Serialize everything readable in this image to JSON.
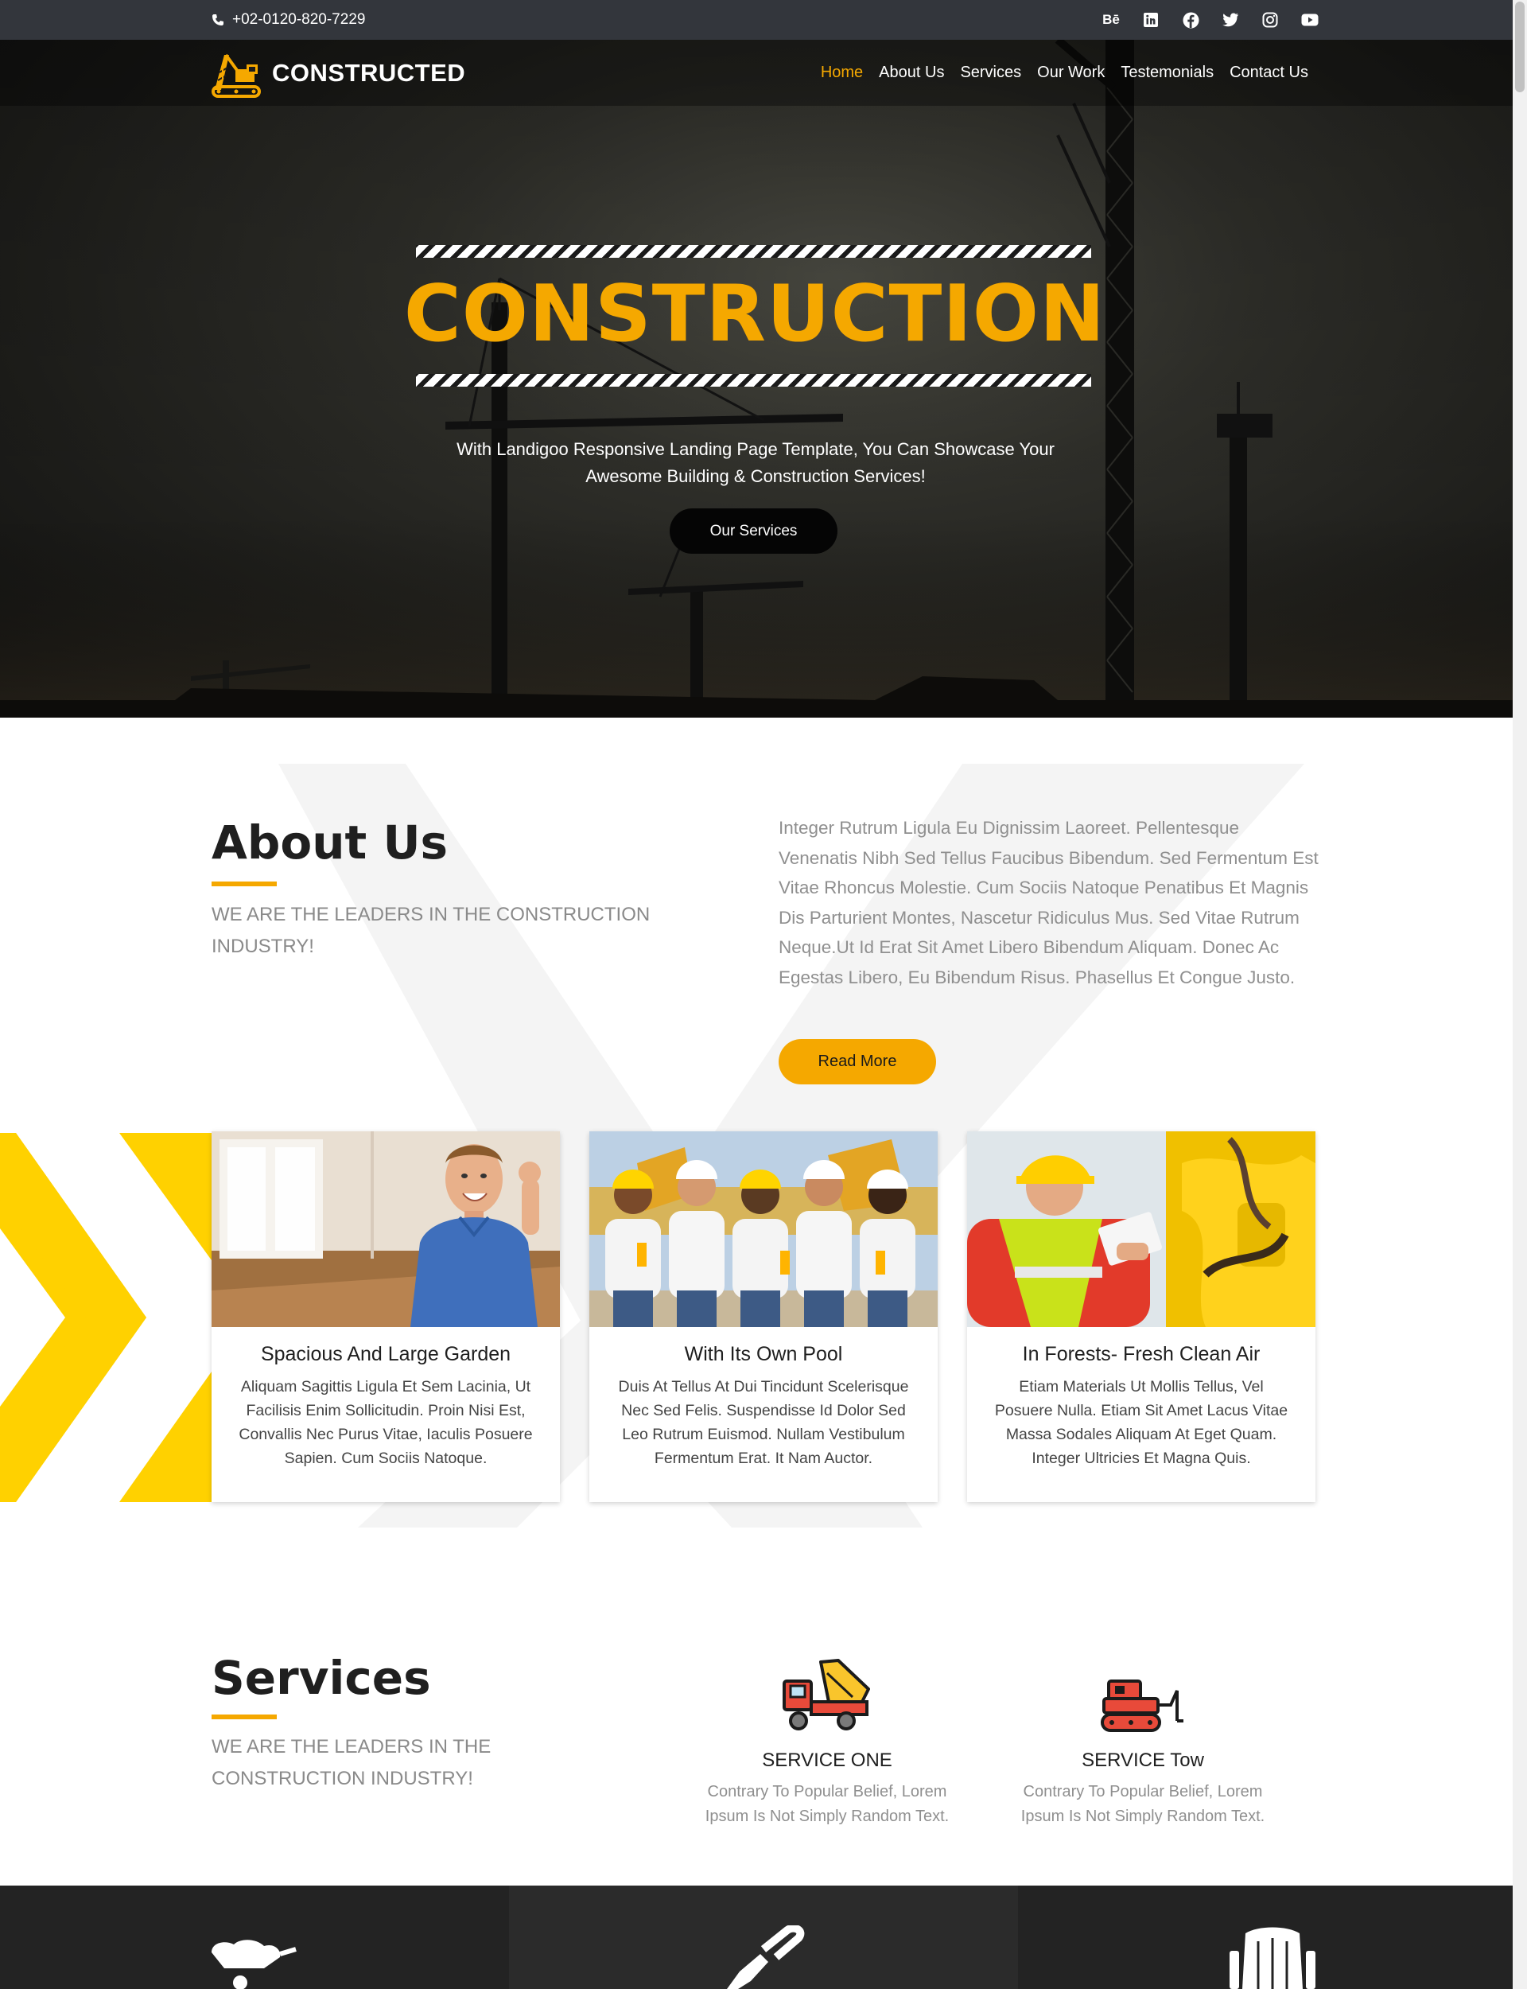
{
  "topbar": {
    "phone": "+02-0120-820-7229",
    "social": [
      {
        "icon": "behance-icon",
        "glyph": "Bē"
      },
      {
        "icon": "linkedin-icon",
        "glyph": "in"
      },
      {
        "icon": "facebook-icon",
        "glyph": "f"
      },
      {
        "icon": "twitter-icon",
        "glyph": "t"
      },
      {
        "icon": "instagram-icon",
        "glyph": "◎"
      },
      {
        "icon": "youtube-icon",
        "glyph": "▶"
      }
    ]
  },
  "brand": {
    "name": "CONSTRUCTED",
    "accent_color": "#f5a800"
  },
  "nav": {
    "items": [
      {
        "label": "Home",
        "active": true
      },
      {
        "label": "About Us",
        "active": false
      },
      {
        "label": "Services",
        "active": false
      },
      {
        "label": "Our Work",
        "active": false
      },
      {
        "label": "Testemonials",
        "active": false
      },
      {
        "label": "Contact Us",
        "active": false
      }
    ]
  },
  "hero": {
    "title": "CONSTRUCTION",
    "subtitle": "With Landigoo Responsive Landing Page Template, You Can Showcase Your Awesome Building & Construction Services!",
    "button": "Our Services"
  },
  "about": {
    "title": "About Us",
    "tagline": "WE ARE THE LEADERS IN THE CONSTRUCTION INDUSTRY!",
    "text": "Integer Rutrum Ligula Eu Dignissim Laoreet. Pellentesque Venenatis Nibh Sed Tellus Faucibus Bibendum. Sed Fermentum Est Vitae Rhoncus Molestie. Cum Sociis Natoque Penatibus Et Magnis Dis Parturient Montes, Nascetur Ridiculus Mus. Sed Vitae Rutrum Neque.Ut Id Erat Sit Amet Libero Bibendum Aliquam. Donec Ac Egestas Libero, Eu Bibendum Risus. Phasellus Et Congue Justo.",
    "button": "Read More"
  },
  "cards": [
    {
      "title": "Spacious And Large Garden",
      "text": "Aliquam Sagittis Ligula Et Sem Lacinia, Ut Facilisis Enim Sollicitudin. Proin Nisi Est, Convallis Nec Purus Vitae, Iaculis Posuere Sapien. Cum Sociis Natoque."
    },
    {
      "title": "With Its Own Pool",
      "text": "Duis At Tellus At Dui Tincidunt Scelerisque Nec Sed Felis. Suspendisse Id Dolor Sed Leo Rutrum Euismod. Nullam Vestibulum Fermentum Erat. It Nam Auctor."
    },
    {
      "title": "In Forests- Fresh Clean Air",
      "text": "Etiam Materials Ut Mollis Tellus, Vel Posuere Nulla. Etiam Sit Amet Lacus Vitae Massa Sodales Aliquam At Eget Quam. Integer Ultricies Et Magna Quis."
    }
  ],
  "services": {
    "title": "Services",
    "tagline": "WE ARE THE LEADERS IN THE CONSTRUCTION INDUSTRY!",
    "items": [
      {
        "name": "SERVICE ONE",
        "text": "Contrary To Popular Belief, Lorem Ipsum Is Not Simply Random Text.",
        "icon": "cement-truck-icon"
      },
      {
        "name": "SERVICE Tow",
        "text": "Contrary To Popular Belief, Lorem Ipsum Is Not Simply Random Text.",
        "icon": "bulldozer-icon"
      }
    ]
  }
}
